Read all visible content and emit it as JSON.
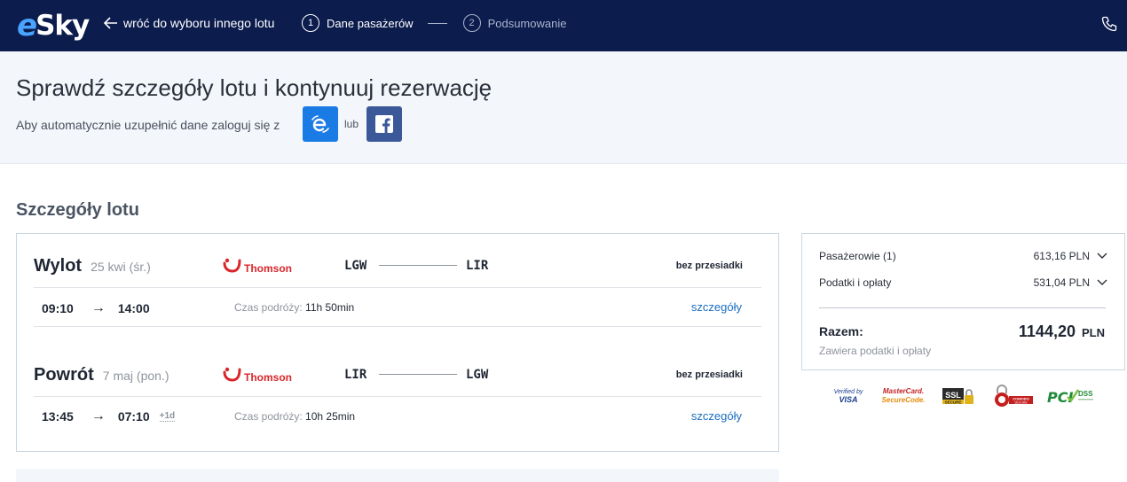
{
  "header": {
    "logo_e": "e",
    "logo_sky": "Sky",
    "back_label": "wróć do wyboru innego lotu",
    "steps": [
      {
        "num": "1",
        "label": "Dane pasażerów"
      },
      {
        "num": "2",
        "label": "Podsumowanie"
      }
    ],
    "phone_icon": "phone-icon",
    "colors": {
      "bar": "#0b1c4d",
      "accent": "#4aa3ff"
    }
  },
  "intro": {
    "title": "Sprawdź szczegóły lotu i kontynuuj rezerwację",
    "login_text": "Aby automatycznie uzupełnić dane zaloguj się z",
    "or_text": "lub"
  },
  "section_title": "Szczegóły lotu",
  "legs": [
    {
      "direction": "Wylot",
      "date": "25 kwi (śr.)",
      "airline": "Thomson",
      "from": "LGW",
      "to": "LIR",
      "stops": "bez przesiadki",
      "dep_time": "09:10",
      "arr_time": "14:00",
      "day_offset": "",
      "duration_label": "Czas podróży:",
      "duration": "11h 50min",
      "details": "szczegóły"
    },
    {
      "direction": "Powrót",
      "date": "7 maj (pon.)",
      "airline": "Thomson",
      "from": "LIR",
      "to": "LGW",
      "stops": "bez przesiadki",
      "dep_time": "13:45",
      "arr_time": "07:10",
      "day_offset": "+1d",
      "duration_label": "Czas podróży:",
      "duration": "10h 25min",
      "details": "szczegóły"
    }
  ],
  "price": {
    "rows": [
      {
        "label": "Pasażerowie (1)",
        "amount": "613,16 PLN"
      },
      {
        "label": "Podatki i opłaty",
        "amount": "531,04 PLN"
      }
    ],
    "total_label": "Razem:",
    "total_amount": "1144,20",
    "total_currency": "PLN",
    "total_note": "Zawiera podatki i opłaty"
  },
  "badges": {
    "visa_top": "Verified by",
    "visa_bottom": "VISA",
    "mc_top": "MasterCard.",
    "mc_bottom": "SecureCode.",
    "ssl_text": "SSL",
    "ssl_sub": "SECURE",
    "comodo_text": "COMODO",
    "comodo_sub": "SECURE",
    "pci_text": "PCI",
    "pci_sub": "DSS"
  }
}
